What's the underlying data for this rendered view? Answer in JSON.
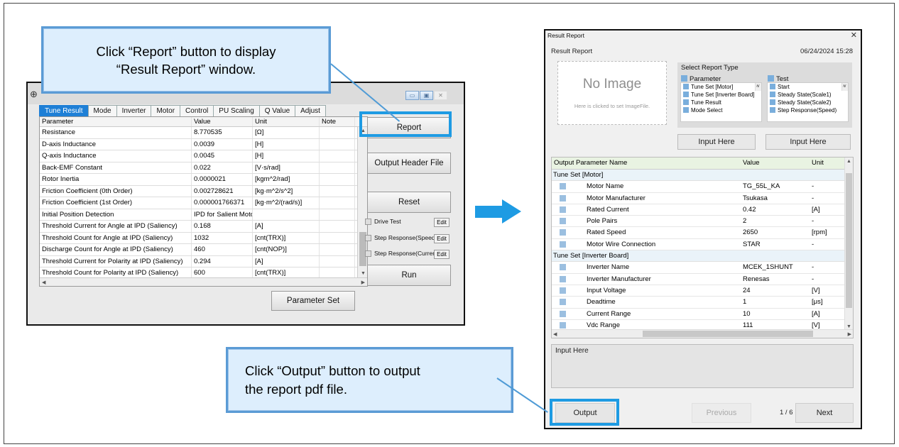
{
  "callouts": {
    "top_line1": "Click “Report” button to display",
    "top_line2": "“Result Report” window.",
    "bottom_line1": "Click “Output” button to output",
    "bottom_line2": "the report pdf file."
  },
  "tuner": {
    "tabs": [
      "Tune Result",
      "Mode",
      "Inverter",
      "Motor",
      "Control",
      "PU Scaling",
      "Q Value",
      "Adjust"
    ],
    "active_tab": "Tune Result",
    "columns": [
      "Parameter",
      "Value",
      "Unit",
      "Note"
    ],
    "rows": [
      [
        "Resistance",
        "8.770535",
        "[Ω]",
        ""
      ],
      [
        "D-axis Inductance",
        "0.0039",
        "[H]",
        ""
      ],
      [
        "Q-axis Inductance",
        "0.0045",
        "[H]",
        ""
      ],
      [
        "Back-EMF Constant",
        "0.022",
        "[V·s/rad]",
        ""
      ],
      [
        "Rotor Inertia",
        "0.0000021",
        "[kgm^2/rad]",
        ""
      ],
      [
        "Friction Coefficient (0th Order)",
        "0.002728621",
        "[kg·m^2/s^2]",
        ""
      ],
      [
        "Friction Coefficient (1st Order)",
        "0.000001766371",
        "[kg·m^2/(rad/s)]",
        ""
      ],
      [
        "Initial Position Detection",
        "IPD for Salient Motor",
        "",
        ""
      ],
      [
        "Threshold Current for Angle at IPD (Saliency)",
        "0.168",
        "[A]",
        ""
      ],
      [
        "Threshold Count for Angle at IPD (Saliency)",
        "1032",
        "[cnt(TRX)]",
        ""
      ],
      [
        "Discharge Count for Angle at IPD (Saliency)",
        "460",
        "[cnt(NOP)]",
        ""
      ],
      [
        "Threshold Current for Polarity at IPD (Saliency)",
        "0.294",
        "[A]",
        ""
      ],
      [
        "Threshold Count for Polarity at IPD (Saliency)",
        "600",
        "[cnt(TRX)]",
        ""
      ]
    ],
    "buttons": {
      "report": "Report",
      "output_header": "Output Header File",
      "reset": "Reset",
      "run": "Run",
      "parameter_set": "Parameter Set",
      "edit": "Edit"
    },
    "checks": [
      "Drive Test",
      "Step Response(Speed)",
      "Step Response(Current)"
    ]
  },
  "report": {
    "window_title": "Result Report",
    "heading": "Result Report",
    "date": "06/24/2024 15:28",
    "no_image": "No Image",
    "no_image_hint": "Here is clicked to set ImageFile.",
    "select_title": "Select Report Type",
    "parameter_label": "Parameter",
    "parameter_items": [
      "Tune Set [Motor]",
      "Tune Set [Inverter Board]",
      "Tune Result",
      "Mode Select"
    ],
    "test_label": "Test",
    "test_items": [
      "Start",
      "Steady State(Scale1)",
      "Steady State(Scale2)",
      "Step Response(Speed)"
    ],
    "input_here_1": "Input Here",
    "input_here_2": "Input Here",
    "columns": [
      "Output",
      "Parameter Name",
      "Value",
      "Unit"
    ],
    "group1": "Tune Set [Motor]",
    "group1_rows": [
      [
        "Motor Name",
        "TG_55L_KA",
        "-"
      ],
      [
        "Motor Manufacturer",
        "Tsukasa",
        "-"
      ],
      [
        "Rated Current",
        "0.42",
        "[A]"
      ],
      [
        "Pole Pairs",
        "2",
        "-"
      ],
      [
        "Rated Speed",
        "2650",
        "[rpm]"
      ],
      [
        "Motor Wire Connection",
        "STAR",
        "-"
      ]
    ],
    "group2": "Tune Set [Inverter Board]",
    "group2_rows": [
      [
        "Inverter Name",
        "MCEK_1SHUNT",
        "-"
      ],
      [
        "Inverter Manufacturer",
        "Renesas",
        "-"
      ],
      [
        "Input Voltage",
        "24",
        "[V]"
      ],
      [
        "Deadtime",
        "1",
        "[μs]"
      ],
      [
        "Current Range",
        "10",
        "[A]"
      ],
      [
        "Vdc Range",
        "111",
        "[V]"
      ]
    ],
    "notes": "Input Here",
    "output": "Output",
    "previous": "Previous",
    "page": "1 / 6",
    "next": "Next"
  },
  "colors": {
    "accent": "#1e9be3",
    "tab_active": "#1e7fd6",
    "callout_bg": "#ddeefd"
  }
}
